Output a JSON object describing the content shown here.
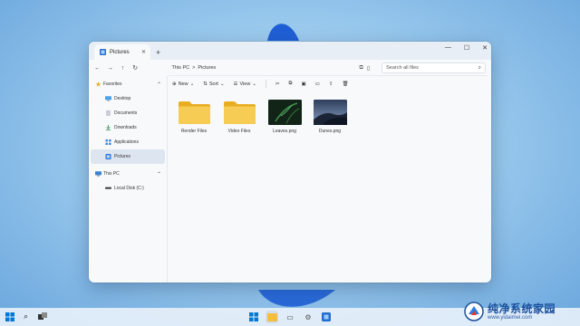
{
  "window": {
    "tab_title": "Pictures",
    "tab_close": "✕",
    "new_tab": "+",
    "controls": [
      "—",
      "☐",
      "✕"
    ]
  },
  "address": {
    "back": "←",
    "forward": "→",
    "up": "↑",
    "refresh": "↻",
    "breadcrumb": [
      "This PC",
      "Pictures"
    ],
    "separator": ">",
    "search_placeholder": "Search all files"
  },
  "sidebar": {
    "groups": [
      {
        "label": "Favorites",
        "icon": "star-icon",
        "items": [
          {
            "label": "Desktop",
            "icon": "desktop-icon"
          },
          {
            "label": "Documents",
            "icon": "documents-icon"
          },
          {
            "label": "Downloads",
            "icon": "download-icon"
          },
          {
            "label": "Applications",
            "icon": "apps-icon"
          },
          {
            "label": "Pictures",
            "icon": "pictures-icon",
            "selected": true
          }
        ]
      },
      {
        "label": "This PC",
        "icon": "pc-icon",
        "items": [
          {
            "label": "Local Disk (C:)",
            "icon": "disk-icon"
          }
        ]
      }
    ]
  },
  "commands": {
    "new": "New",
    "sort": "Sort",
    "view": "View"
  },
  "files": [
    {
      "name": "Render Files",
      "type": "folder"
    },
    {
      "name": "Video Files",
      "type": "folder"
    },
    {
      "name": "Leaves.png",
      "type": "image-leaves"
    },
    {
      "name": "Dunes.png",
      "type": "image-dunes"
    }
  ],
  "watermark": {
    "title": "纯净系统家园",
    "url": "www.yidaimei.com"
  },
  "colors": {
    "accent": "#0067c0",
    "folder": "#f5c54a"
  }
}
